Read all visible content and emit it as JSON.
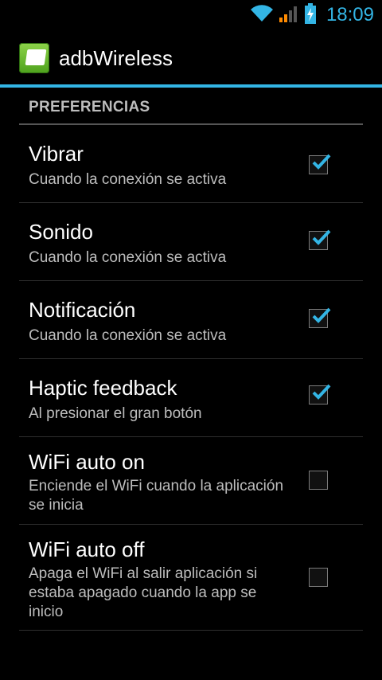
{
  "status_bar": {
    "time": "18:09",
    "icons": [
      "wifi-icon",
      "signal-icon",
      "battery-charging-icon"
    ]
  },
  "action_bar": {
    "title": "adbWireless",
    "icon": "adb-app-icon"
  },
  "section": {
    "header": "PREFERENCIAS"
  },
  "preferences": [
    {
      "title": "Vibrar",
      "summary": "Cuando la conexión se activa",
      "checked": true
    },
    {
      "title": "Sonido",
      "summary": "Cuando la conexión se activa",
      "checked": true
    },
    {
      "title": "Notificación",
      "summary": "Cuando la conexión se activa",
      "checked": true
    },
    {
      "title": "Haptic feedback",
      "summary": "Al presionar el gran botón",
      "checked": true
    },
    {
      "title": "WiFi auto on",
      "summary": "Enciende el WiFi cuando la aplicación se inicia",
      "checked": false
    },
    {
      "title": "WiFi auto off",
      "summary": "Apaga el WiFi al salir aplicación si estaba apagado cuando la app se inicio",
      "checked": false
    }
  ],
  "colors": {
    "accent": "#33b5e5",
    "background": "#000000",
    "summary_text": "#bdbdbd"
  }
}
